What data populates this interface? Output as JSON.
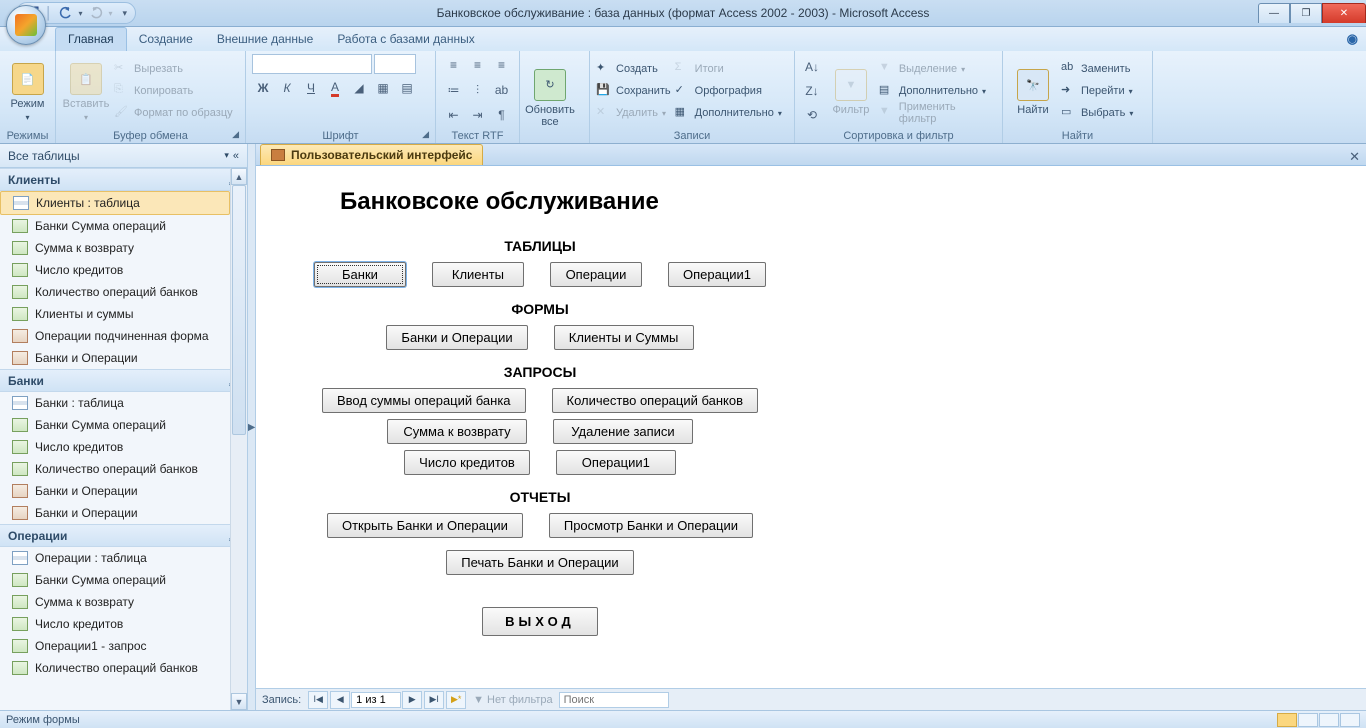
{
  "window": {
    "title": "Банковское обслуживание : база данных (формат Access 2002 - 2003) - Microsoft Access"
  },
  "tabs": {
    "home": "Главная",
    "create": "Создание",
    "external": "Внешние данные",
    "dbtools": "Работа с базами данных"
  },
  "ribbon": {
    "view": "Режим",
    "views_group": "Режимы",
    "paste": "Вставить",
    "cut": "Вырезать",
    "copy": "Копировать",
    "format_painter": "Формат по образцу",
    "clipboard_group": "Буфер обмена",
    "font_group": "Шрифт",
    "textrtf_group": "Текст RTF",
    "refresh": "Обновить все",
    "new": "Создать",
    "save": "Сохранить",
    "delete": "Удалить",
    "totals": "Итоги",
    "spelling": "Орфография",
    "more": "Дополнительно",
    "records_group": "Записи",
    "filter": "Фильтр",
    "selection": "Выделение",
    "advanced": "Дополнительно",
    "toggle_filter": "Применить фильтр",
    "sort_group": "Сортировка и фильтр",
    "find": "Найти",
    "replace": "Заменить",
    "goto": "Перейти",
    "select": "Выбрать",
    "find_group": "Найти"
  },
  "nav": {
    "header": "Все таблицы",
    "groups": [
      {
        "title": "Клиенты",
        "items": [
          {
            "icon": "table",
            "label": "Клиенты : таблица",
            "selected": true
          },
          {
            "icon": "query",
            "label": "Банки Сумма операций"
          },
          {
            "icon": "query",
            "label": "Сумма к возврату"
          },
          {
            "icon": "query",
            "label": "Число кредитов"
          },
          {
            "icon": "query",
            "label": "Количество операций банков"
          },
          {
            "icon": "query",
            "label": "Клиенты и суммы"
          },
          {
            "icon": "form",
            "label": "Операции подчиненная форма"
          },
          {
            "icon": "form",
            "label": "Банки и Операции"
          }
        ]
      },
      {
        "title": "Банки",
        "items": [
          {
            "icon": "table",
            "label": "Банки : таблица"
          },
          {
            "icon": "query",
            "label": "Банки Сумма операций"
          },
          {
            "icon": "query",
            "label": "Число кредитов"
          },
          {
            "icon": "query",
            "label": "Количество операций банков"
          },
          {
            "icon": "form",
            "label": "Банки и Операции"
          },
          {
            "icon": "form",
            "label": "Банки и Операции"
          }
        ]
      },
      {
        "title": "Операции",
        "items": [
          {
            "icon": "table",
            "label": "Операции : таблица"
          },
          {
            "icon": "query",
            "label": "Банки Сумма операций"
          },
          {
            "icon": "query",
            "label": "Сумма к возврату"
          },
          {
            "icon": "query",
            "label": "Число кредитов"
          },
          {
            "icon": "query",
            "label": "Операции1 - запрос"
          },
          {
            "icon": "query",
            "label": "Количество операций банков"
          }
        ]
      }
    ]
  },
  "doctab": "Пользовательский интерфейс",
  "form": {
    "title": "Банковсоке обслуживание",
    "sec_tables": "ТАБЛИЦЫ",
    "btn_banks": "Банки",
    "btn_clients": "Клиенты",
    "btn_ops": "Операции",
    "btn_ops1": "Операции1",
    "sec_forms": "ФОРМЫ",
    "btn_banks_ops": "Банки и Операции",
    "btn_clients_sums": "Клиенты и Суммы",
    "sec_queries": "ЗАПРОСЫ",
    "btn_input_sum": "Ввод суммы операций банка",
    "btn_count_ops": "Количество операций банков",
    "btn_sum_return": "Сумма к возврату",
    "btn_del_rec": "Удаление записи",
    "btn_credit_count": "Число кредитов",
    "btn_ops1q": "Операции1",
    "sec_reports": "ОТЧЕТЫ",
    "btn_open_banks_ops": "Открыть Банки и Операции",
    "btn_preview_banks_ops": "Просмотр Банки и Операции",
    "btn_print_banks_ops": "Печать Банки и Операции",
    "btn_exit": "ВЫХОД"
  },
  "recnav": {
    "label": "Запись:",
    "pos": "1 из 1",
    "filter": "Нет фильтра",
    "search": "Поиск"
  },
  "status": "Режим формы"
}
